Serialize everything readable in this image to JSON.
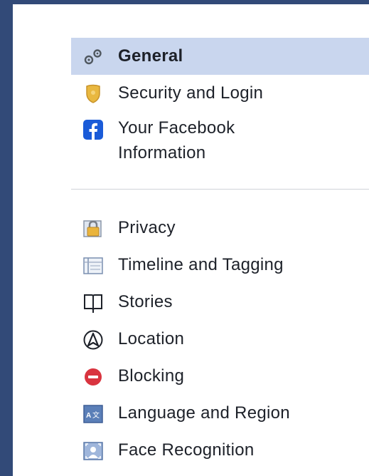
{
  "menu": {
    "group1": [
      {
        "id": "general",
        "label": "General",
        "icon": "gears-icon",
        "active": true
      },
      {
        "id": "security",
        "label": "Security and Login",
        "icon": "shield-badge-icon"
      },
      {
        "id": "your-info",
        "label": "Your Facebook\nInformation",
        "icon": "facebook-icon"
      }
    ],
    "group2": [
      {
        "id": "privacy",
        "label": "Privacy",
        "icon": "padlock-icon"
      },
      {
        "id": "timeline",
        "label": "Timeline and Tagging",
        "icon": "timeline-icon"
      },
      {
        "id": "stories",
        "label": "Stories",
        "icon": "book-icon"
      },
      {
        "id": "location",
        "label": "Location",
        "icon": "location-arrow-icon"
      },
      {
        "id": "blocking",
        "label": "Blocking",
        "icon": "no-entry-icon"
      },
      {
        "id": "language",
        "label": "Language and Region",
        "icon": "translate-icon"
      },
      {
        "id": "face",
        "label": "Face Recognition",
        "icon": "face-frame-icon"
      }
    ]
  },
  "colors": {
    "frame": "#324a78",
    "active_bg": "#c9d6ee",
    "facebook_blue": "#1a5bd8",
    "blocking_red": "#d9343f"
  }
}
